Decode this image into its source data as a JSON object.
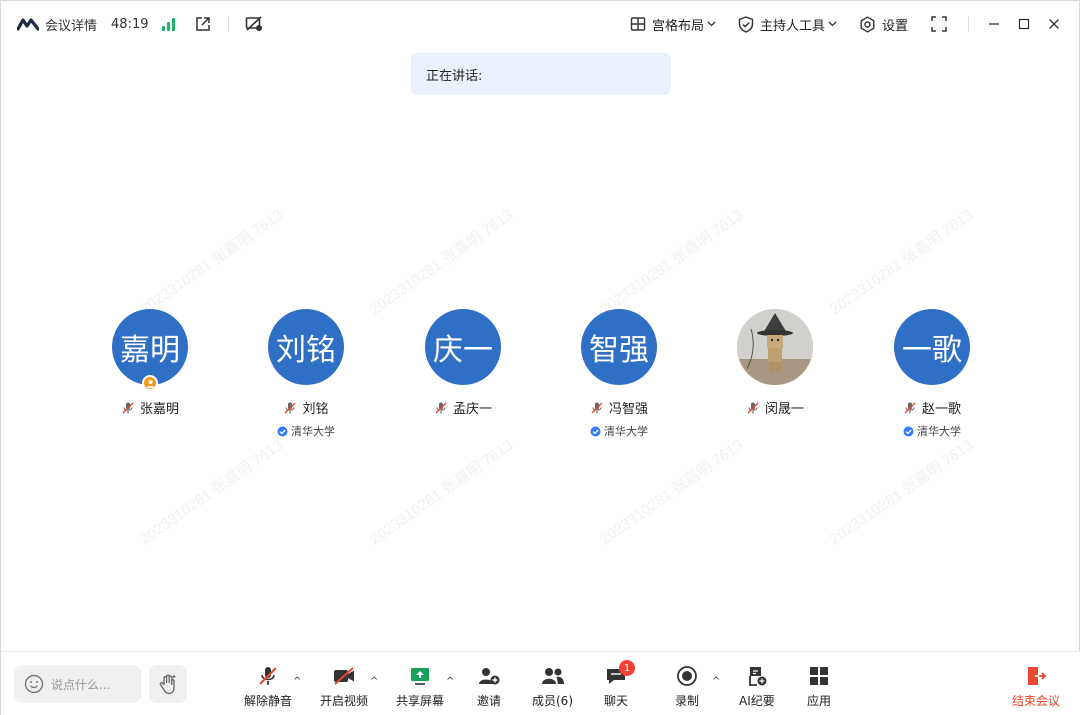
{
  "topbar": {
    "meeting_info": "会议详情",
    "timer": "48:19",
    "layout_label": "宫格布局",
    "host_tools_label": "主持人工具",
    "settings_label": "设置"
  },
  "speaking": {
    "label": "正在讲话:"
  },
  "watermark": "2023310281 张嘉明 7613",
  "participants": [
    {
      "avatar_text": "嘉明",
      "name": "张嘉明",
      "org": "",
      "is_host": true
    },
    {
      "avatar_text": "刘铭",
      "name": "刘铭",
      "org": "清华大学",
      "is_host": false
    },
    {
      "avatar_text": "庆一",
      "name": "孟庆一",
      "org": "",
      "is_host": false
    },
    {
      "avatar_text": "智强",
      "name": "冯智强",
      "org": "清华大学",
      "is_host": false
    },
    {
      "avatar_text": "",
      "name": "闵晟一",
      "org": "",
      "is_host": false,
      "photo": true
    },
    {
      "avatar_text": "一歌",
      "name": "赵一歌",
      "org": "清华大学",
      "is_host": false
    }
  ],
  "bottombar": {
    "chat_placeholder": "说点什么...",
    "unmute": "解除静音",
    "start_video": "开启视频",
    "share_screen": "共享屏幕",
    "invite": "邀请",
    "members": "成员(6)",
    "chat": "聊天",
    "chat_badge": "1",
    "record": "录制",
    "ai_minutes": "AI纪要",
    "apps": "应用",
    "end_meeting": "结束会议"
  },
  "colors": {
    "avatar_blue": "#2f6fc6",
    "host_badge": "#f39a1c",
    "end_red": "#e8482f",
    "signal_green": "#20b26b",
    "speaking_bg": "#eaf1fd"
  }
}
